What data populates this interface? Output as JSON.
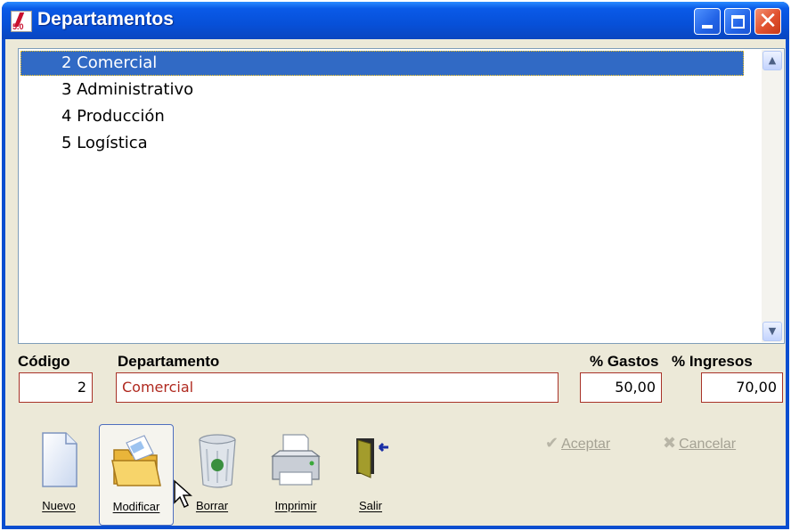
{
  "window": {
    "title": "Departamentos",
    "icon_version_text": "5.0"
  },
  "list": {
    "items": [
      {
        "label": "2 Comercial",
        "selected": true
      },
      {
        "label": "3 Administrativo",
        "selected": false
      },
      {
        "label": "4 Producción",
        "selected": false
      },
      {
        "label": "5 Logística",
        "selected": false
      }
    ]
  },
  "form": {
    "codigo_label": "Código",
    "codigo_value": "2",
    "departamento_label": "Departamento",
    "departamento_value": "Comercial",
    "gastos_label": "% Gastos",
    "gastos_value": "50,00",
    "ingresos_label": "% Ingresos",
    "ingresos_value": "70,00"
  },
  "toolbar": {
    "nuevo_label": "Nuevo",
    "modificar_label": "Modificar",
    "borrar_label": "Borrar",
    "imprimir_label": "Imprimir",
    "salir_label": "Salir",
    "aceptar_label": "Aceptar",
    "cancelar_label": "Cancelar"
  },
  "icons": {
    "titlebar": [
      "app-icon",
      "minimize-icon",
      "maximize-icon",
      "close-icon"
    ],
    "toolbar": [
      "new-document-icon",
      "open-folder-icon",
      "recycle-bin-icon",
      "printer-icon",
      "exit-door-icon",
      "checkmark-icon",
      "cancel-x-icon"
    ]
  },
  "colors": {
    "titlebar": "#0a5ae8",
    "selection": "#316ac5",
    "field_border": "#a83228",
    "disabled_text": "#a5a294"
  }
}
